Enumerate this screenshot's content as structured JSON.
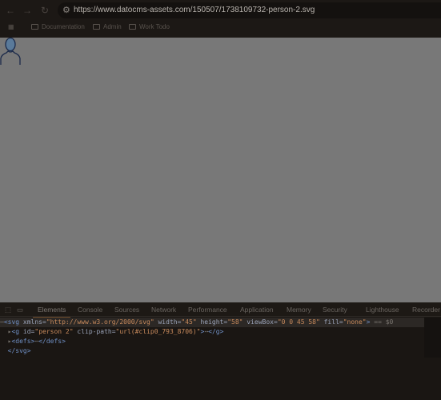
{
  "browser": {
    "url": "https://www.datocms-assets.com/150507/1738109732-person-2.svg",
    "bookmarks": [
      {
        "label": "Documentation"
      },
      {
        "label": "Admin"
      },
      {
        "label": "Work Todo"
      }
    ]
  },
  "page": {
    "image": "person-icon",
    "colors": {
      "background": "#787878",
      "figure_fill": "#5a7a9a",
      "figure_stroke": "#1b2a4a"
    }
  },
  "devtools": {
    "tabs": [
      {
        "label": "Elements",
        "active": true
      },
      {
        "label": "Console"
      },
      {
        "label": "Sources"
      },
      {
        "label": "Network"
      },
      {
        "label": "Performance"
      },
      {
        "label": "Application"
      },
      {
        "label": "Memory"
      },
      {
        "label": "Security"
      },
      {
        "label": "Lighthouse"
      },
      {
        "label": "Recorder"
      }
    ],
    "lines": {
      "l1": {
        "open": "<svg",
        "a1": " xmlns=",
        "v1": "\"http://www.w3.org/2000/svg\"",
        "a2": " width=",
        "v2": "\"45\"",
        "a3": " height=",
        "v3": "\"58\"",
        "a4": " viewBox=",
        "v4": "\"0 0 45 58\"",
        "a5": " fill=",
        "v5": "\"none\"",
        "close": ">",
        "suffix": " == $0"
      },
      "l2": {
        "open": "<g",
        "a1": " id=",
        "v1": "\"person 2\"",
        "a2": " clip-path=",
        "v2": "\"url(#clip0_793_8706)\"",
        "close": ">",
        "ellipsis": "⋯",
        "end": "</g>"
      },
      "l3": {
        "open": "<defs>",
        "ellipsis": "⋯",
        "end": "</defs>"
      },
      "l4": {
        "end": "</svg>"
      }
    }
  }
}
